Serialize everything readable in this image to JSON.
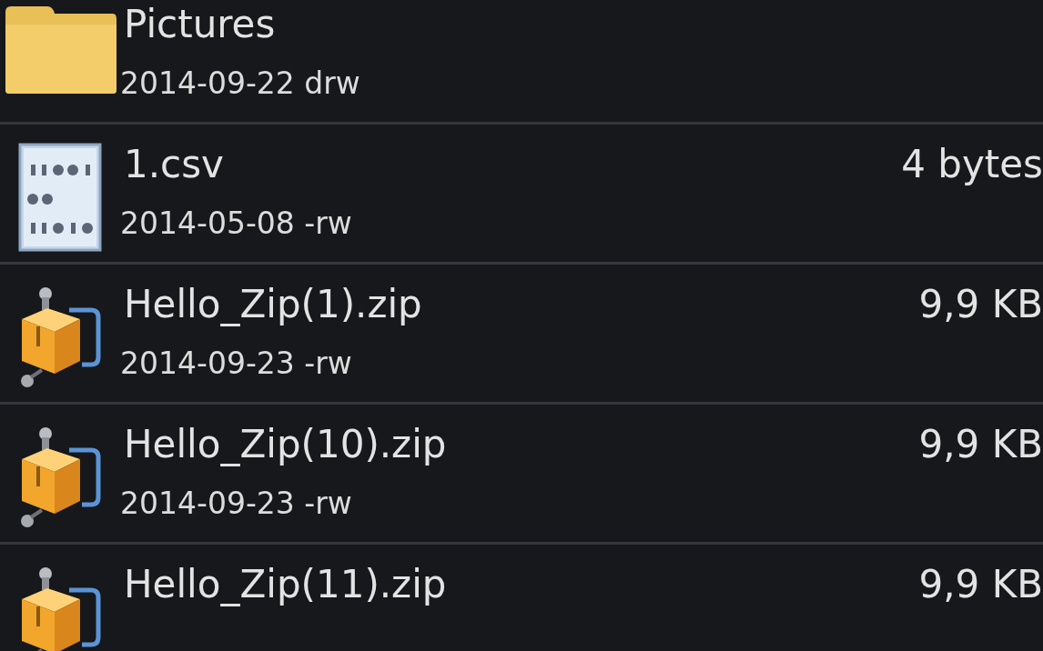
{
  "files": [
    {
      "kind": "folder",
      "name": "Pictures",
      "details": "2014-09-22 drw"
    },
    {
      "kind": "data",
      "name": "1.csv",
      "size": "4 bytes",
      "details": "2014-05-08 -rw"
    },
    {
      "kind": "archive",
      "name": "Hello_Zip(1).zip",
      "size": "9,9 KB",
      "details": "2014-09-23 -rw"
    },
    {
      "kind": "archive",
      "name": "Hello_Zip(10).zip",
      "size": "9,9 KB",
      "details": "2014-09-23 -rw"
    },
    {
      "kind": "archive",
      "name": "Hello_Zip(11).zip",
      "size": "9,9 KB"
    }
  ]
}
